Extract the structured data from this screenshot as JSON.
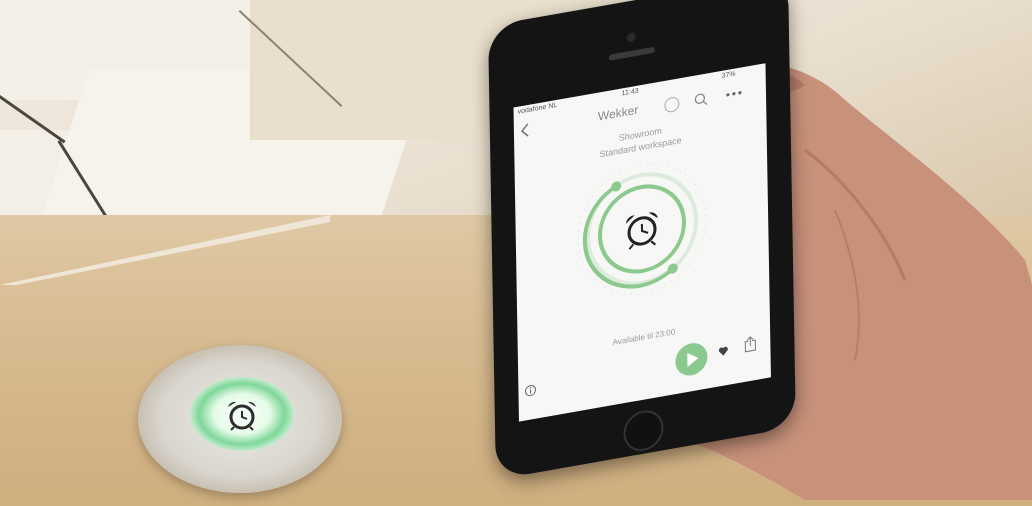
{
  "phone_app": {
    "status_bar": {
      "carrier": "vodafone NL",
      "time": "11:43",
      "battery": "37%"
    },
    "header_title": "Wekker",
    "location": "Showroom",
    "workspace": "Standard workspace",
    "availability": "Available til 23:00",
    "accent_color": "#8cc98e",
    "icons": [
      "back-icon",
      "search-icon",
      "more-icon",
      "alarm-clock-icon",
      "play-icon",
      "heart-icon",
      "share-icon",
      "info-icon"
    ]
  }
}
